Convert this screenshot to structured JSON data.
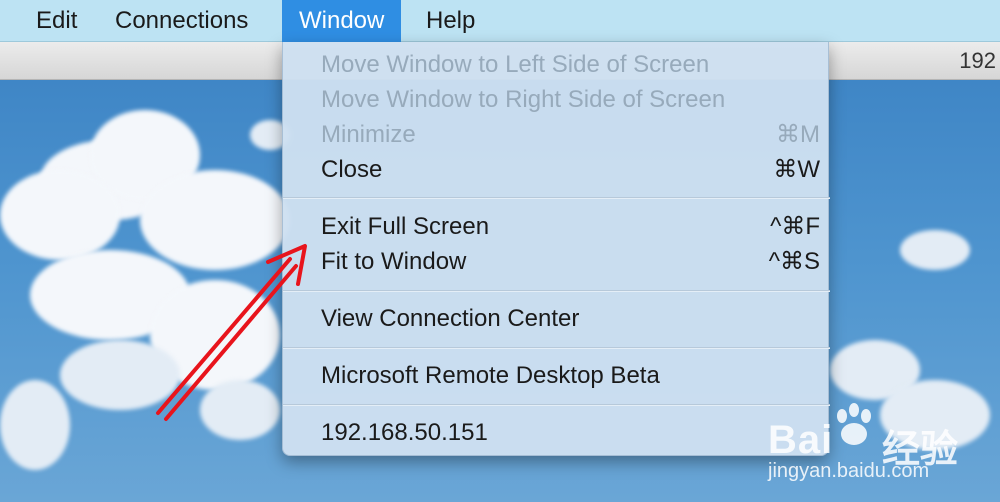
{
  "menubar": {
    "items": [
      {
        "label": "Edit"
      },
      {
        "label": "Connections"
      },
      {
        "label": "Window",
        "active": true
      },
      {
        "label": "Help"
      }
    ]
  },
  "titlebar": {
    "text": "192"
  },
  "window_menu": {
    "items": [
      {
        "label": "Move Window to Left Side of Screen",
        "shortcut": "",
        "enabled": false
      },
      {
        "label": "Move Window to Right Side of Screen",
        "shortcut": "",
        "enabled": false
      },
      {
        "label": "Minimize",
        "shortcut": "⌘M",
        "enabled": false
      },
      {
        "label": "Close",
        "shortcut": "⌘W",
        "enabled": true
      },
      {
        "label": "Exit Full Screen",
        "shortcut": "^⌘F",
        "enabled": true
      },
      {
        "label": "Fit to Window",
        "shortcut": "^⌘S",
        "enabled": true
      },
      {
        "label": "View Connection Center",
        "shortcut": "",
        "enabled": true
      },
      {
        "label": "Microsoft Remote Desktop Beta",
        "shortcut": "",
        "enabled": true
      },
      {
        "label": "192.168.50.151",
        "shortcut": "",
        "enabled": true
      }
    ]
  },
  "watermark": {
    "brand": "Bai",
    "brand_cn": "经验",
    "url": "jingyan.baidu.com"
  },
  "colors": {
    "menubar_bg": "#bde3f3",
    "active_menu_bg": "#2f8ee3",
    "annotation_arrow": "#e8141c",
    "disabled_text": "#97aabb"
  }
}
